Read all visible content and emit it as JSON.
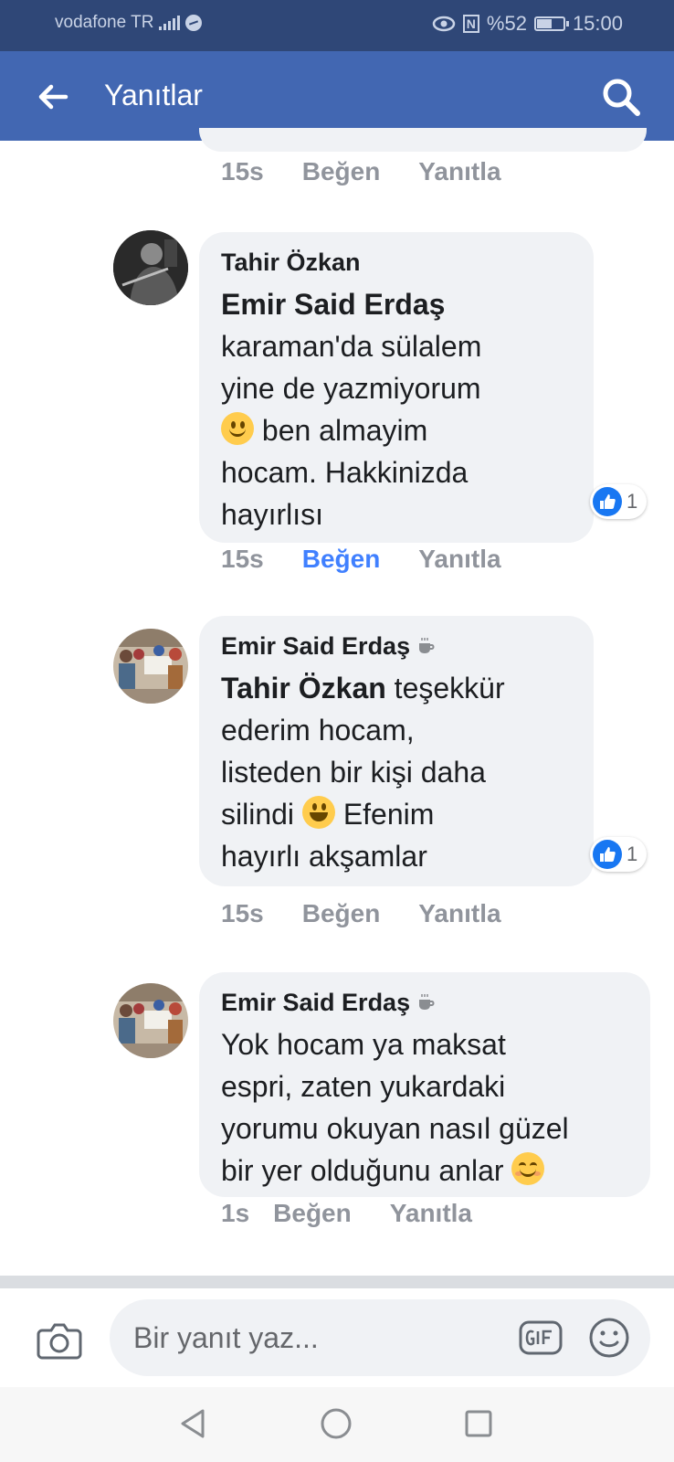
{
  "status_bar": {
    "carrier": "vodafone TR",
    "battery": "%52",
    "time": "15:00"
  },
  "app_bar": {
    "title": "Yanıtlar"
  },
  "previous_comment_actions": {
    "time": "15s",
    "like": "Beğen",
    "reply": "Yanıtla"
  },
  "comments": [
    {
      "author": "Tahir Özkan",
      "mention": "Emir Said Erdaş",
      "text_line1": "karaman'da sülalem",
      "text_line2": "yine de yazmiyorum",
      "text_line3_after_emoji": " ben almayim",
      "text_line4": "hocam. Hakkinizda",
      "text_line5": "hayırlısı",
      "reaction_count": "1",
      "time": "15s",
      "like": "Beğen",
      "reply": "Yanıtla",
      "liked": true,
      "emoji": "slightly-smiling-face"
    },
    {
      "author": "Emir Said Erdaş",
      "mention": "Tahir Özkan",
      "text_line1_after_mention": " teşekkür",
      "text_line2": "ederim hocam,",
      "text_line3": "listeden bir kişi daha",
      "text_line4_before_emoji": "silindi ",
      "text_line4_after_emoji": " Efenim",
      "text_line5": "hayırlı akşamlar",
      "reaction_count": "1",
      "time": "15s",
      "like": "Beğen",
      "reply": "Yanıtla",
      "liked": false,
      "emoji": "grinning-face"
    },
    {
      "author": "Emir Said Erdaş",
      "text_line1": "Yok hocam ya maksat",
      "text_line2": "espri, zaten yukardaki",
      "text_line3": "yorumu okuyan nasıl güzel",
      "text_line4_before_emoji": "bir yer olduğunu anlar ",
      "time": "1s",
      "like": "Beğen",
      "reply": "Yanıtla",
      "liked": false,
      "emoji": "smiling-face-with-smiling-eyes"
    }
  ],
  "composer": {
    "placeholder": "Bir yanıt yaz..."
  },
  "colors": {
    "header_blue": "#4267b2",
    "status_bar": "#2f4777",
    "bubble": "#f0f2f5",
    "liked_blue": "#4080ff",
    "action_gray": "#90949c"
  }
}
